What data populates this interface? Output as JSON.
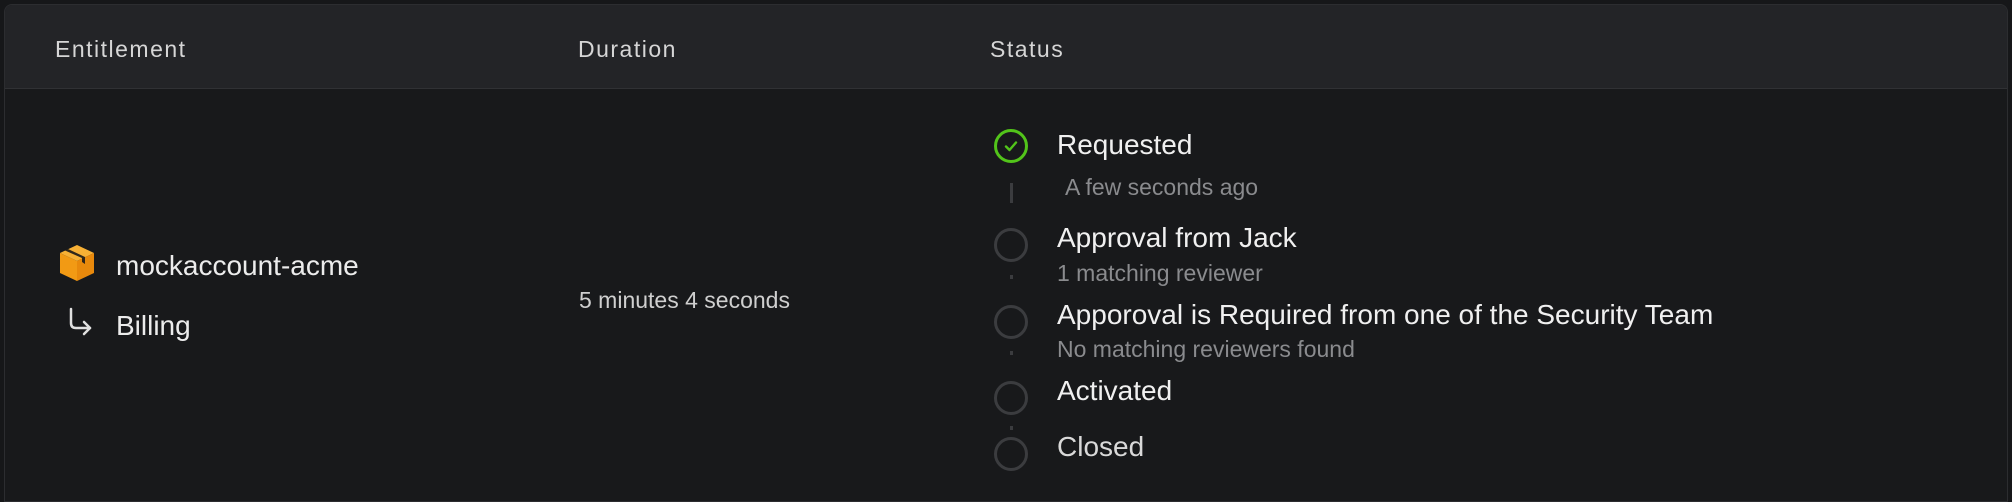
{
  "header": {
    "entitlement": "Entitlement",
    "duration": "Duration",
    "status": "Status"
  },
  "row": {
    "account": "mockaccount-acme",
    "role": "Billing",
    "duration": "5 minutes 4 seconds",
    "icons": {
      "account": "aws-box-icon",
      "role": "return-arrow-icon"
    }
  },
  "status_steps": [
    {
      "title": "Requested",
      "subtitle": "A few seconds ago",
      "state": "done"
    },
    {
      "title": "Approval from Jack",
      "subtitle": "1 matching reviewer",
      "state": "pending"
    },
    {
      "title": "Apporoval is Required from one of the Security Team",
      "subtitle": "No matching reviewers found",
      "state": "pending"
    },
    {
      "title": "Activated",
      "subtitle": "",
      "state": "pending"
    },
    {
      "title": "Closed",
      "subtitle": "",
      "state": "pending"
    }
  ],
  "colors": {
    "done": "#52c41a",
    "pending": "#3b3c3f",
    "icon_orange": "#f5a623"
  }
}
